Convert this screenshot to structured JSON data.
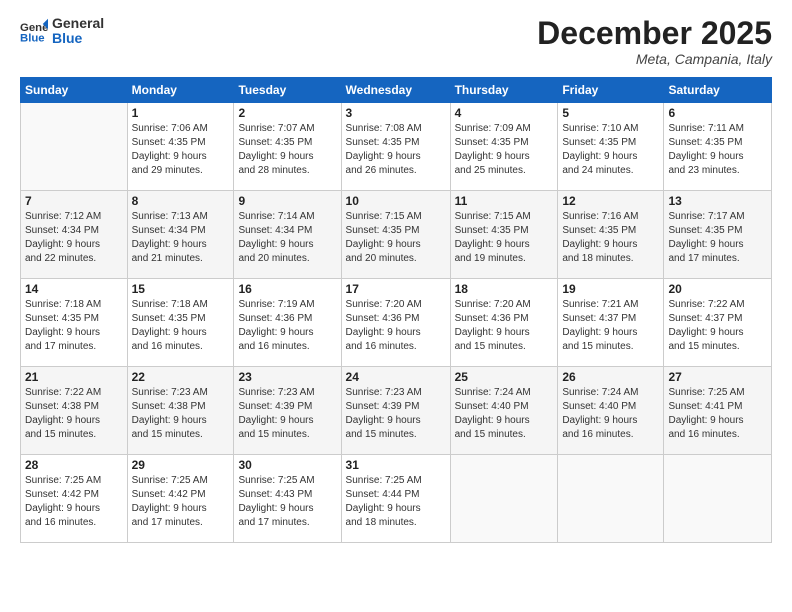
{
  "header": {
    "logo_general": "General",
    "logo_blue": "Blue",
    "month_title": "December 2025",
    "location": "Meta, Campania, Italy"
  },
  "days_of_week": [
    "Sunday",
    "Monday",
    "Tuesday",
    "Wednesday",
    "Thursday",
    "Friday",
    "Saturday"
  ],
  "weeks": [
    [
      {
        "day": "",
        "info": ""
      },
      {
        "day": "1",
        "info": "Sunrise: 7:06 AM\nSunset: 4:35 PM\nDaylight: 9 hours\nand 29 minutes."
      },
      {
        "day": "2",
        "info": "Sunrise: 7:07 AM\nSunset: 4:35 PM\nDaylight: 9 hours\nand 28 minutes."
      },
      {
        "day": "3",
        "info": "Sunrise: 7:08 AM\nSunset: 4:35 PM\nDaylight: 9 hours\nand 26 minutes."
      },
      {
        "day": "4",
        "info": "Sunrise: 7:09 AM\nSunset: 4:35 PM\nDaylight: 9 hours\nand 25 minutes."
      },
      {
        "day": "5",
        "info": "Sunrise: 7:10 AM\nSunset: 4:35 PM\nDaylight: 9 hours\nand 24 minutes."
      },
      {
        "day": "6",
        "info": "Sunrise: 7:11 AM\nSunset: 4:35 PM\nDaylight: 9 hours\nand 23 minutes."
      }
    ],
    [
      {
        "day": "7",
        "info": "Sunrise: 7:12 AM\nSunset: 4:34 PM\nDaylight: 9 hours\nand 22 minutes."
      },
      {
        "day": "8",
        "info": "Sunrise: 7:13 AM\nSunset: 4:34 PM\nDaylight: 9 hours\nand 21 minutes."
      },
      {
        "day": "9",
        "info": "Sunrise: 7:14 AM\nSunset: 4:34 PM\nDaylight: 9 hours\nand 20 minutes."
      },
      {
        "day": "10",
        "info": "Sunrise: 7:15 AM\nSunset: 4:35 PM\nDaylight: 9 hours\nand 20 minutes."
      },
      {
        "day": "11",
        "info": "Sunrise: 7:15 AM\nSunset: 4:35 PM\nDaylight: 9 hours\nand 19 minutes."
      },
      {
        "day": "12",
        "info": "Sunrise: 7:16 AM\nSunset: 4:35 PM\nDaylight: 9 hours\nand 18 minutes."
      },
      {
        "day": "13",
        "info": "Sunrise: 7:17 AM\nSunset: 4:35 PM\nDaylight: 9 hours\nand 17 minutes."
      }
    ],
    [
      {
        "day": "14",
        "info": "Sunrise: 7:18 AM\nSunset: 4:35 PM\nDaylight: 9 hours\nand 17 minutes."
      },
      {
        "day": "15",
        "info": "Sunrise: 7:18 AM\nSunset: 4:35 PM\nDaylight: 9 hours\nand 16 minutes."
      },
      {
        "day": "16",
        "info": "Sunrise: 7:19 AM\nSunset: 4:36 PM\nDaylight: 9 hours\nand 16 minutes."
      },
      {
        "day": "17",
        "info": "Sunrise: 7:20 AM\nSunset: 4:36 PM\nDaylight: 9 hours\nand 16 minutes."
      },
      {
        "day": "18",
        "info": "Sunrise: 7:20 AM\nSunset: 4:36 PM\nDaylight: 9 hours\nand 15 minutes."
      },
      {
        "day": "19",
        "info": "Sunrise: 7:21 AM\nSunset: 4:37 PM\nDaylight: 9 hours\nand 15 minutes."
      },
      {
        "day": "20",
        "info": "Sunrise: 7:22 AM\nSunset: 4:37 PM\nDaylight: 9 hours\nand 15 minutes."
      }
    ],
    [
      {
        "day": "21",
        "info": "Sunrise: 7:22 AM\nSunset: 4:38 PM\nDaylight: 9 hours\nand 15 minutes."
      },
      {
        "day": "22",
        "info": "Sunrise: 7:23 AM\nSunset: 4:38 PM\nDaylight: 9 hours\nand 15 minutes."
      },
      {
        "day": "23",
        "info": "Sunrise: 7:23 AM\nSunset: 4:39 PM\nDaylight: 9 hours\nand 15 minutes."
      },
      {
        "day": "24",
        "info": "Sunrise: 7:23 AM\nSunset: 4:39 PM\nDaylight: 9 hours\nand 15 minutes."
      },
      {
        "day": "25",
        "info": "Sunrise: 7:24 AM\nSunset: 4:40 PM\nDaylight: 9 hours\nand 15 minutes."
      },
      {
        "day": "26",
        "info": "Sunrise: 7:24 AM\nSunset: 4:40 PM\nDaylight: 9 hours\nand 16 minutes."
      },
      {
        "day": "27",
        "info": "Sunrise: 7:25 AM\nSunset: 4:41 PM\nDaylight: 9 hours\nand 16 minutes."
      }
    ],
    [
      {
        "day": "28",
        "info": "Sunrise: 7:25 AM\nSunset: 4:42 PM\nDaylight: 9 hours\nand 16 minutes."
      },
      {
        "day": "29",
        "info": "Sunrise: 7:25 AM\nSunset: 4:42 PM\nDaylight: 9 hours\nand 17 minutes."
      },
      {
        "day": "30",
        "info": "Sunrise: 7:25 AM\nSunset: 4:43 PM\nDaylight: 9 hours\nand 17 minutes."
      },
      {
        "day": "31",
        "info": "Sunrise: 7:25 AM\nSunset: 4:44 PM\nDaylight: 9 hours\nand 18 minutes."
      },
      {
        "day": "",
        "info": ""
      },
      {
        "day": "",
        "info": ""
      },
      {
        "day": "",
        "info": ""
      }
    ]
  ]
}
